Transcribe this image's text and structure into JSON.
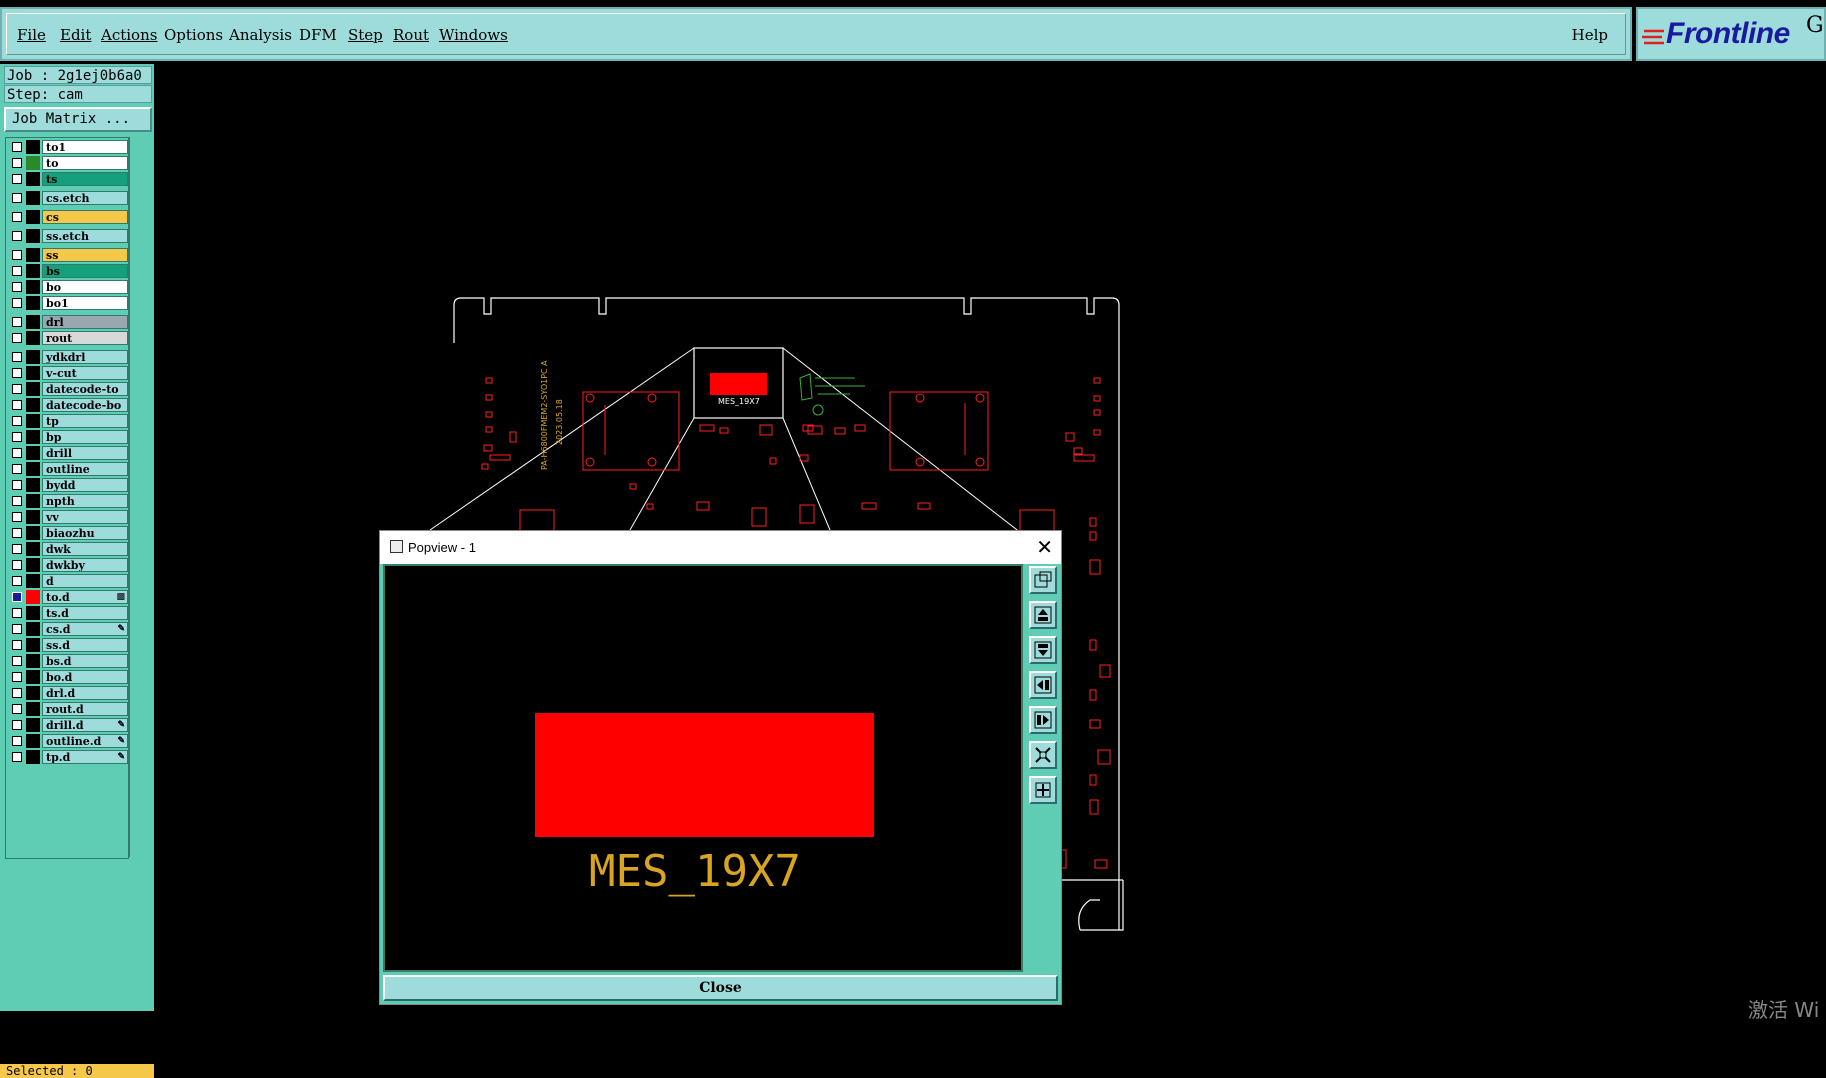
{
  "menu": {
    "items": [
      "File",
      "Edit",
      "Actions",
      "Options",
      "Analysis",
      "DFM",
      "Step",
      "Rout",
      "Windows"
    ],
    "help": "Help"
  },
  "logo": {
    "text": "Frontline",
    "extra": "G"
  },
  "info": {
    "job": "Job : 2g1ej0b6a0",
    "step": "Step: cam",
    "job_matrix": "Job Matrix ..."
  },
  "layers": [
    {
      "name": "to1",
      "bg": "#ffffff",
      "swatch": "#000000"
    },
    {
      "name": "to",
      "bg": "#ffffff",
      "swatch": "#2a8a2a"
    },
    {
      "name": "ts",
      "bg": "#13a07a",
      "swatch": "#000000"
    },
    {
      "name": "cs.etch",
      "bg": "#9edcdc",
      "swatch": "#000000"
    },
    {
      "name": "cs",
      "bg": "#f5c84a",
      "swatch": "#000000"
    },
    {
      "name": "ss.etch",
      "bg": "#9edcdc",
      "swatch": "#000000"
    },
    {
      "name": "ss",
      "bg": "#f5c84a",
      "swatch": "#000000"
    },
    {
      "name": "bs",
      "bg": "#13a07a",
      "swatch": "#000000"
    },
    {
      "name": "bo",
      "bg": "#ffffff",
      "swatch": "#000000"
    },
    {
      "name": "bo1",
      "bg": "#ffffff",
      "swatch": "#000000"
    },
    {
      "name": "drl",
      "bg": "#9aa6b0",
      "swatch": "#000000"
    },
    {
      "name": "rout",
      "bg": "#d8d8d8",
      "swatch": "#000000"
    },
    {
      "name": "ydkdrl",
      "bg": "#9edcdc",
      "swatch": "#000000"
    },
    {
      "name": "v-cut",
      "bg": "#9edcdc",
      "swatch": "#000000"
    },
    {
      "name": "datecode-to",
      "bg": "#9edcdc",
      "swatch": "#000000"
    },
    {
      "name": "datecode-bo",
      "bg": "#9edcdc",
      "swatch": "#000000"
    },
    {
      "name": "tp",
      "bg": "#9edcdc",
      "swatch": "#000000"
    },
    {
      "name": "bp",
      "bg": "#9edcdc",
      "swatch": "#000000"
    },
    {
      "name": "drill",
      "bg": "#9edcdc",
      "swatch": "#000000"
    },
    {
      "name": "outline",
      "bg": "#9edcdc",
      "swatch": "#000000"
    },
    {
      "name": "bydd",
      "bg": "#9edcdc",
      "swatch": "#000000"
    },
    {
      "name": "npth",
      "bg": "#9edcdc",
      "swatch": "#000000"
    },
    {
      "name": "vv",
      "bg": "#9edcdc",
      "swatch": "#000000"
    },
    {
      "name": "biaozhu",
      "bg": "#9edcdc",
      "swatch": "#000000"
    },
    {
      "name": "dwk",
      "bg": "#9edcdc",
      "swatch": "#000000"
    },
    {
      "name": "dwkby",
      "bg": "#9edcdc",
      "swatch": "#000000"
    },
    {
      "name": "d",
      "bg": "#9edcdc",
      "swatch": "#000000"
    },
    {
      "name": "to.d",
      "bg": "#9edcdc",
      "swatch": "#ff0000",
      "checked": true,
      "mark": "▩"
    },
    {
      "name": "ts.d",
      "bg": "#9edcdc",
      "swatch": "#000000"
    },
    {
      "name": "cs.d",
      "bg": "#9edcdc",
      "swatch": "#000000",
      "mark": "✎"
    },
    {
      "name": "ss.d",
      "bg": "#9edcdc",
      "swatch": "#000000"
    },
    {
      "name": "bs.d",
      "bg": "#9edcdc",
      "swatch": "#000000"
    },
    {
      "name": "bo.d",
      "bg": "#9edcdc",
      "swatch": "#000000"
    },
    {
      "name": "drl.d",
      "bg": "#9edcdc",
      "swatch": "#000000"
    },
    {
      "name": "rout.d",
      "bg": "#9edcdc",
      "swatch": "#000000"
    },
    {
      "name": "drill.d",
      "bg": "#9edcdc",
      "swatch": "#000000",
      "mark": "✎"
    },
    {
      "name": "outline.d",
      "bg": "#9edcdc",
      "swatch": "#000000",
      "mark": "✎"
    },
    {
      "name": "tp.d",
      "bg": "#9edcdc",
      "swatch": "#000000",
      "mark": "✎"
    }
  ],
  "status": {
    "selected": "Selected : 0"
  },
  "board": {
    "component_label": "MES_19X7",
    "vertical_text_1": "PA-H6800FMEM2-SYO1PC A",
    "vertical_text_2": "2023.05.18"
  },
  "popview": {
    "title": "Popview - 1",
    "close_label": "Close",
    "component_label": "MES_19X7"
  },
  "watermark": "激活 Wi",
  "colors": {
    "teal": "#5ecdb4",
    "light_teal": "#9edcdc",
    "trace_red": "#ff2020",
    "label_gold": "#d9a520"
  }
}
